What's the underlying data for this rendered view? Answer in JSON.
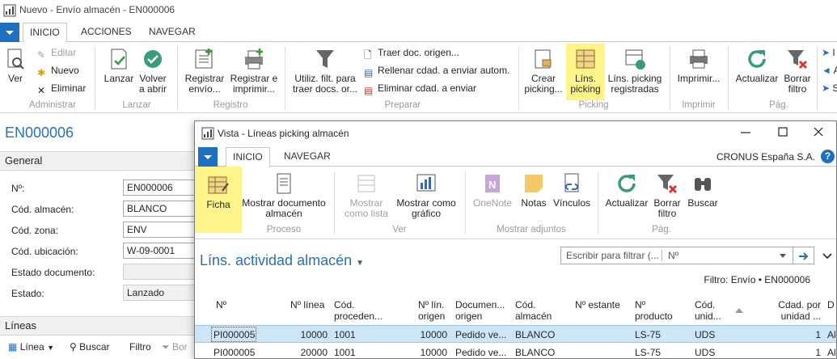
{
  "back": {
    "title": "Nuevo - Envío almacén - EN000006",
    "tabs": [
      "INICIO",
      "ACCIONES",
      "NAVEGAR"
    ],
    "ribbon": {
      "ver": "Ver",
      "editar": "Editar",
      "nuevo": "Nuevo",
      "eliminar": "Eliminar",
      "lanzar": "Lanzar",
      "volver_abrir": "Volver a abrir",
      "registrar_envio": "Registrar envío...",
      "registrar_imprimir": "Registrar e imprimir...",
      "utiliz_filt": "Utiliz. filt. para traer docs. or...",
      "traer_doc": "Traer doc. origen...",
      "rellenar": "Rellenar cdad. a enviar autom.",
      "eliminar_cdad": "Eliminar cdad. a enviar",
      "crear_picking": "Crear picking...",
      "lins_picking": "Líns. picking",
      "lins_picking_reg": "Líns. picking registradas",
      "imprimir": "Imprimir...",
      "actualizar": "Actualizar",
      "borrar_filtro": "Borrar filtro",
      "cut_i": "I",
      "cut_a": "A",
      "cut_s": "S",
      "groups": {
        "administrar": "Administrar",
        "lanzar": "Lanzar",
        "registro": "Registro",
        "preparar": "Preparar",
        "picking": "Picking",
        "imprimir": "Imprimir",
        "pag": "Pág."
      }
    },
    "card_title": "EN000006",
    "general_label": "General",
    "fields": [
      {
        "label": "Nº:",
        "value": "EN000006",
        "readonly": false
      },
      {
        "label": "Cód. almacén:",
        "value": "BLANCO",
        "readonly": false
      },
      {
        "label": "Cód. zona:",
        "value": "ENV",
        "readonly": false
      },
      {
        "label": "Cód. ubicación:",
        "value": "W-09-0001",
        "readonly": false
      },
      {
        "label": "Estado documento:",
        "value": "",
        "readonly": true
      },
      {
        "label": "Estado:",
        "value": "Lanzado",
        "readonly": true
      }
    ],
    "lines_label": "Líneas",
    "lines_bar": {
      "linea": "Línea",
      "buscar": "Buscar",
      "filtro": "Filtro",
      "borrar": "Bor"
    }
  },
  "front": {
    "title": "Vista - Líneas picking almacén",
    "tabs": [
      "INICIO",
      "NAVEGAR"
    ],
    "company": "CRONUS España S.A.",
    "help": "?",
    "ribbon": {
      "ficha": "Ficha",
      "mostrar_doc": "Mostrar documento almacén",
      "mostrar_lista": "Mostrar como lista",
      "mostrar_grafico": "Mostrar como gráfico",
      "onenote": "OneNote",
      "notas": "Notas",
      "vinculos": "Vínculos",
      "actualizar": "Actualizar",
      "borrar_filtro": "Borrar filtro",
      "buscar": "Buscar",
      "groups": {
        "proceso": "Proceso",
        "ver": "Ver",
        "adjuntos": "Mostrar adjuntos",
        "pag": "Pág."
      }
    },
    "list_title": "Líns. actividad almacén",
    "search_placeholder": "Escribir para filtrar (...",
    "search_field": "Nº",
    "filter_info": "Filtro: Envío • EN000006",
    "columns": [
      "Nº",
      "Nº línea",
      "Cód. proceden...",
      "Nº lín. origen",
      "Documen... origen",
      "Cód. almacén",
      "Nº estante",
      "Nº producto",
      "Cód. unid...",
      "Cdad. por unidad ...",
      "D"
    ],
    "rows": [
      {
        "no": "PI000005",
        "linea": "10000",
        "proc": "1001",
        "lin_origen": "10000",
        "doc": "Pedido ve...",
        "alm": "BLANCO",
        "estante": "",
        "prod": "LS-75",
        "unid": "UDS",
        "cdad": "1",
        "d": "Alr"
      },
      {
        "no": "PI000005",
        "linea": "20000",
        "proc": "1001",
        "lin_origen": "10000",
        "doc": "Pedido ve...",
        "alm": "BLANCO",
        "estante": "",
        "prod": "LS-75",
        "unid": "UDS",
        "cdad": "1",
        "d": "Alr"
      }
    ]
  }
}
